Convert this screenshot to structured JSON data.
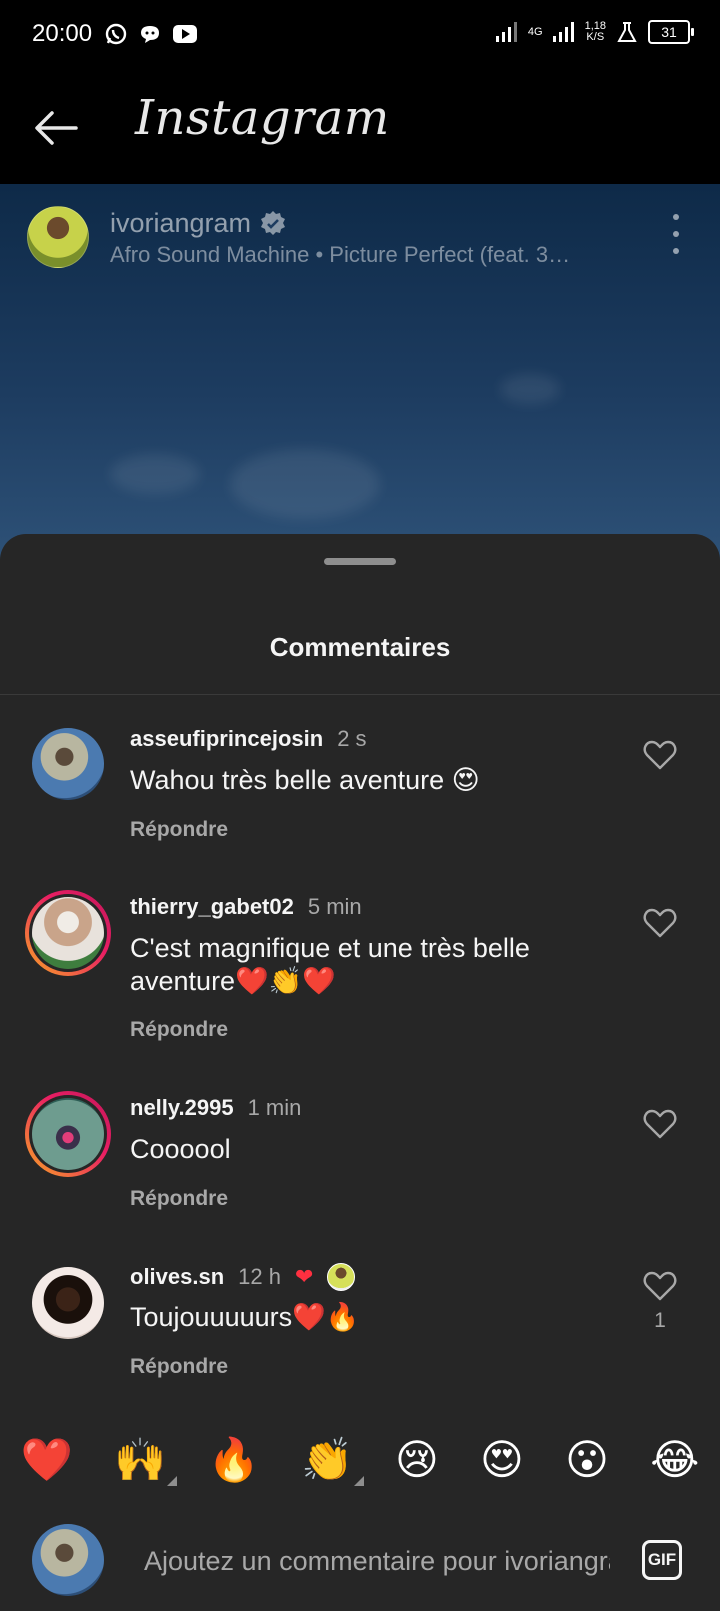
{
  "status_bar": {
    "time": "20:00",
    "left_icons": [
      "whatsapp-icon",
      "chat-bubble-icon",
      "youtube-icon"
    ],
    "network_type": "4G",
    "network_speed_value": "1,18",
    "network_speed_unit": "K/S",
    "battery_level": "31"
  },
  "header": {
    "back_icon": "arrow-left-icon",
    "title": "Instagram"
  },
  "post": {
    "username": "ivoriangram",
    "verified": true,
    "audio": "Afro Sound Machine • Picture Perfect (feat. 3…"
  },
  "comments_sheet": {
    "title": "Commentaires",
    "reply_label": "Répondre",
    "comments": [
      {
        "username": "asseufiprincejosin",
        "time": "2 s",
        "text": "Wahou très belle aventure 😍",
        "likes": ""
      },
      {
        "username": "thierry_gabet02",
        "time": "5 min",
        "text": "C'est magnifique et une très belle aventure❤️👏❤️",
        "likes": ""
      },
      {
        "username": "nelly.2995",
        "time": "1 min",
        "text": "Coooool",
        "likes": ""
      },
      {
        "username": "olives.sn",
        "time": "12 h",
        "text": "Toujouuuuurs❤️🔥",
        "likes": "1"
      }
    ]
  },
  "emoji_bar": [
    "❤️",
    "🙌",
    "🔥",
    "👏",
    "😢",
    "😍",
    "😮",
    "😂"
  ],
  "input": {
    "placeholder": "Ajoutez un commentaire pour ivoriangram...",
    "gif_label": "GIF"
  },
  "colors": {
    "sheet_bg": "#262626",
    "like_red": "#ff3040",
    "muted_text": "#a8a8a8"
  }
}
